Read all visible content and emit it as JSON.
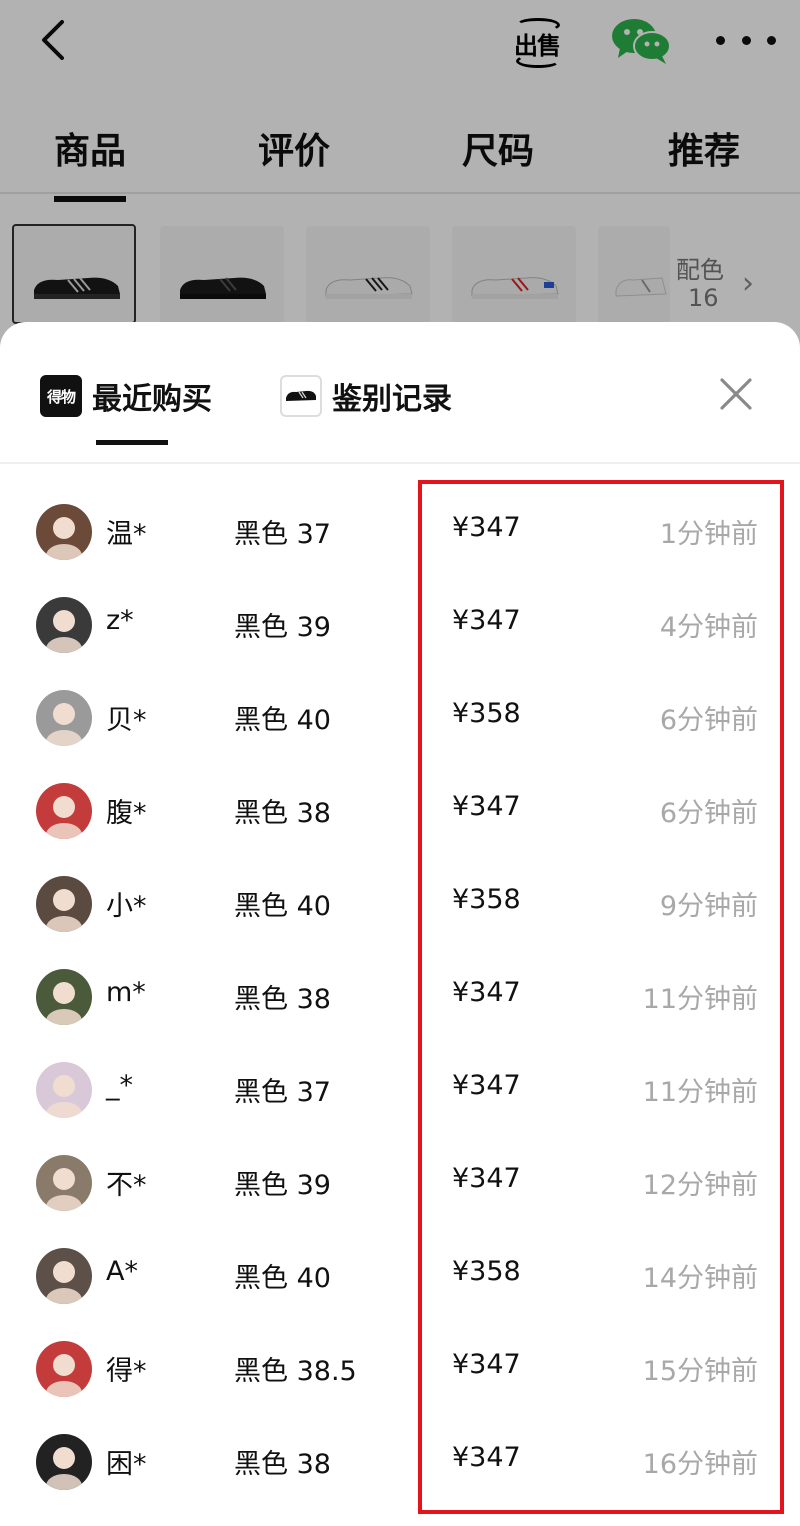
{
  "topbar": {
    "sell_label": "出售",
    "icons": [
      "back-icon",
      "sell-icon",
      "wechat-icon",
      "more-icon"
    ]
  },
  "tabs": [
    {
      "label": "商品",
      "active": true
    },
    {
      "label": "评价",
      "active": false
    },
    {
      "label": "尺码",
      "active": false
    },
    {
      "label": "推荐",
      "active": false
    }
  ],
  "color_picker": {
    "label": "配色",
    "count": "16"
  },
  "sheet": {
    "tabs": [
      {
        "label": "最近购买",
        "icon": "dewu-logo",
        "logo_text": "得物",
        "active": true
      },
      {
        "label": "鉴别记录",
        "icon": "shoe-thumbnail",
        "active": false
      }
    ],
    "close_icon": "close-icon"
  },
  "purchases": [
    {
      "user": "温*",
      "spec": "黑色 37",
      "price": "¥347",
      "time": "1分钟前",
      "avatar_color": "#6b4a3a"
    },
    {
      "user": "z*",
      "spec": "黑色 39",
      "price": "¥347",
      "time": "4分钟前",
      "avatar_color": "#3a3a3a"
    },
    {
      "user": "贝*",
      "spec": "黑色 40",
      "price": "¥358",
      "time": "6分钟前",
      "avatar_color": "#9a9a9a"
    },
    {
      "user": "腹*",
      "spec": "黑色 38",
      "price": "¥347",
      "time": "6分钟前",
      "avatar_color": "#c43b3b"
    },
    {
      "user": "小*",
      "spec": "黑色 40",
      "price": "¥358",
      "time": "9分钟前",
      "avatar_color": "#5a4a40"
    },
    {
      "user": "m*",
      "spec": "黑色 38",
      "price": "¥347",
      "time": "11分钟前",
      "avatar_color": "#4a5a3a"
    },
    {
      "user": "_*",
      "spec": "黑色 37",
      "price": "¥347",
      "time": "11分钟前",
      "avatar_color": "#d9c8d8"
    },
    {
      "user": "不*",
      "spec": "黑色 39",
      "price": "¥347",
      "time": "12分钟前",
      "avatar_color": "#8a7a6a"
    },
    {
      "user": "A*",
      "spec": "黑色 40",
      "price": "¥358",
      "time": "14分钟前",
      "avatar_color": "#5c5048"
    },
    {
      "user": "得*",
      "spec": "黑色 38.5",
      "price": "¥347",
      "time": "15分钟前",
      "avatar_color": "#c43b3b"
    },
    {
      "user": "困*",
      "spec": "黑色 38",
      "price": "¥347",
      "time": "16分钟前",
      "avatar_color": "#222222"
    }
  ],
  "colors": {
    "highlight": "#e3141b",
    "time_text": "#a8a8a8",
    "primary_text": "#111111"
  }
}
